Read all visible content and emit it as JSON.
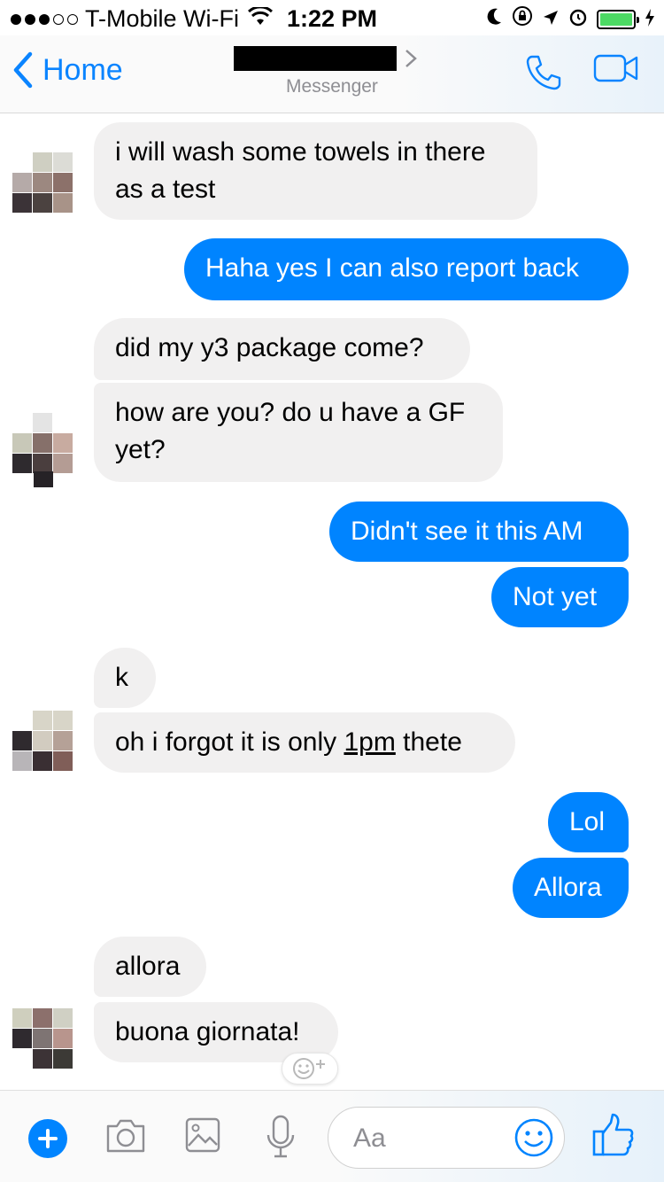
{
  "status_bar": {
    "carrier": "T-Mobile Wi-Fi",
    "time": "1:22 PM"
  },
  "nav": {
    "back_label": "Home",
    "subtitle": "Messenger"
  },
  "messages": [
    {
      "side": "in",
      "text_lines": [
        "i will wash some towels in there",
        "as a test"
      ]
    },
    {
      "side": "out",
      "text": "Haha yes I can also report back"
    },
    {
      "side": "in",
      "text": "did my y3 package come?"
    },
    {
      "side": "in",
      "text_lines": [
        "how are you? do u have a GF",
        "yet?"
      ]
    },
    {
      "side": "out",
      "text": "Didn't see it this AM"
    },
    {
      "side": "out",
      "text": "Not yet"
    },
    {
      "side": "in",
      "text": "k"
    },
    {
      "side": "in",
      "text_before": "oh i forgot it is only ",
      "text_link": "1pm",
      "text_after": " thete"
    },
    {
      "side": "out",
      "text": "Lol"
    },
    {
      "side": "out",
      "text": "Allora"
    },
    {
      "side": "in",
      "text": "allora"
    },
    {
      "side": "in",
      "text": "buona giornata!"
    }
  ],
  "composer": {
    "placeholder": "Aa"
  },
  "colors": {
    "accent": "#0084ff",
    "incoming_bubble": "#f1f0f0"
  }
}
